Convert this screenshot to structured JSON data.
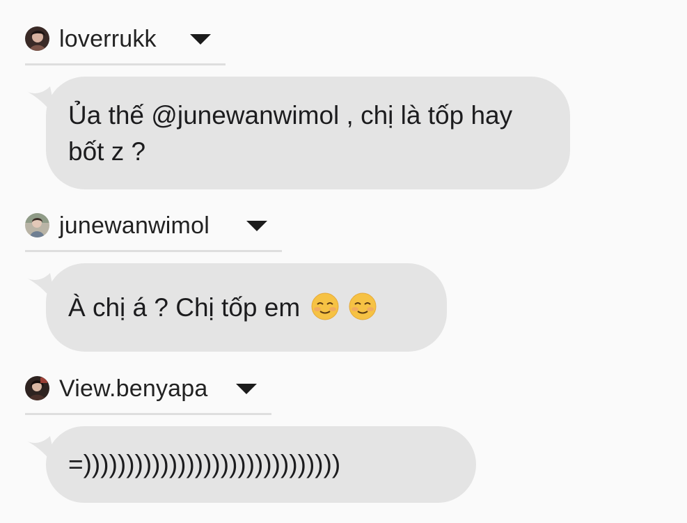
{
  "colors": {
    "background": "#fafafa",
    "bubble": "#e4e4e4",
    "divider": "#dedede",
    "text": "#1c1c1e"
  },
  "messages": [
    {
      "username": "loverrukk",
      "avatar_icon": "user-avatar-icon",
      "dropdown_icon": "chevron-down-icon",
      "text": "Ủa thế @junewanwimol , chị là tốp hay bốt z ?"
    },
    {
      "username": "junewanwimol",
      "avatar_icon": "user-avatar-icon",
      "dropdown_icon": "chevron-down-icon",
      "text": "À chị á ? Chị tốp em ",
      "emojis": [
        "☺️",
        "☺️"
      ]
    },
    {
      "username": "View.benyapa",
      "avatar_icon": "user-avatar-icon",
      "dropdown_icon": "chevron-down-icon",
      "text": "=))))))))))))))))))))))))))))))"
    }
  ]
}
